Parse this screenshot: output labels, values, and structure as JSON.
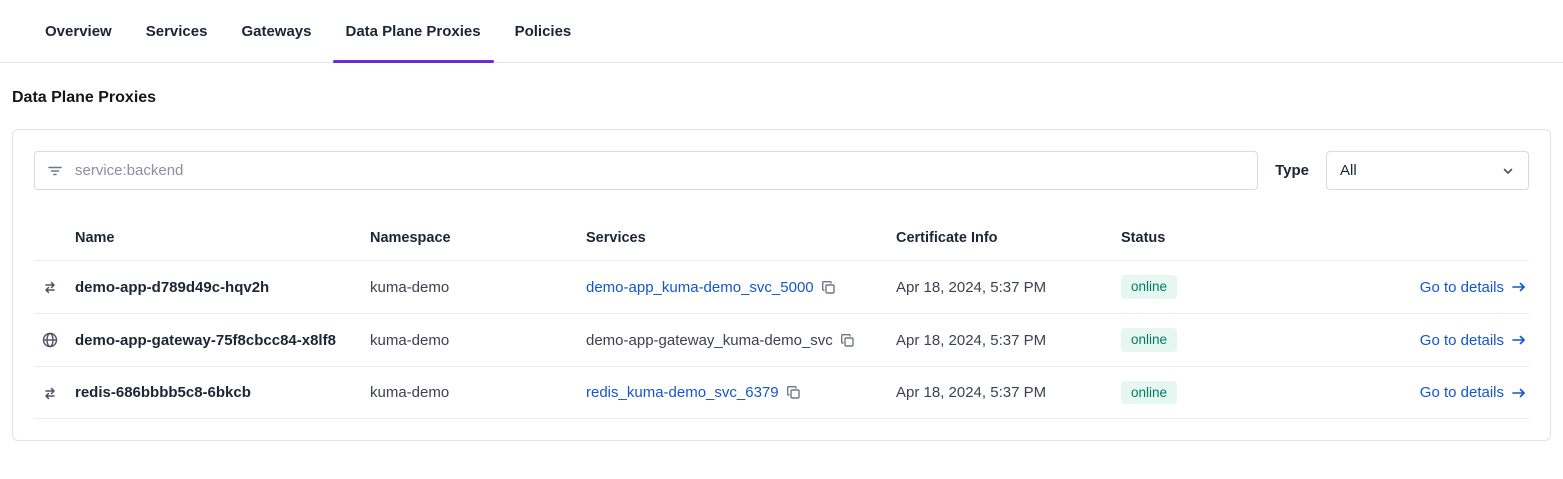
{
  "tabs": {
    "items": [
      {
        "label": "Overview"
      },
      {
        "label": "Services"
      },
      {
        "label": "Gateways"
      },
      {
        "label": "Data Plane Proxies"
      },
      {
        "label": "Policies"
      }
    ],
    "active": "Data Plane Proxies"
  },
  "page_title": "Data Plane Proxies",
  "filter": {
    "placeholder": "service:backend"
  },
  "type_filter": {
    "label": "Type",
    "selected": "All"
  },
  "table": {
    "headers": {
      "name": "Name",
      "namespace": "Namespace",
      "services": "Services",
      "certificate": "Certificate Info",
      "status": "Status"
    },
    "rows": [
      {
        "icon": "proxy-arrows-icon",
        "name": "demo-app-d789d49c-hqv2h",
        "namespace": "kuma-demo",
        "service": "demo-app_kuma-demo_svc_5000",
        "service_is_link": true,
        "certificate": "Apr 18, 2024, 5:37 PM",
        "status": "online",
        "action": "Go to details"
      },
      {
        "icon": "gateway-globe-icon",
        "name": "demo-app-gateway-75f8cbcc84-x8lf8",
        "namespace": "kuma-demo",
        "service": "demo-app-gateway_kuma-demo_svc",
        "service_is_link": false,
        "certificate": "Apr 18, 2024, 5:37 PM",
        "status": "online",
        "action": "Go to details"
      },
      {
        "icon": "proxy-arrows-icon",
        "name": "redis-686bbbb5c8-6bkcb",
        "namespace": "kuma-demo",
        "service": "redis_kuma-demo_svc_6379",
        "service_is_link": true,
        "certificate": "Apr 18, 2024, 5:37 PM",
        "status": "online",
        "action": "Go to details"
      }
    ]
  },
  "colors": {
    "accent_purple": "#6c2bd9",
    "link_blue": "#1456cb",
    "badge_bg": "#e6f6f0",
    "badge_text": "#007d60"
  }
}
